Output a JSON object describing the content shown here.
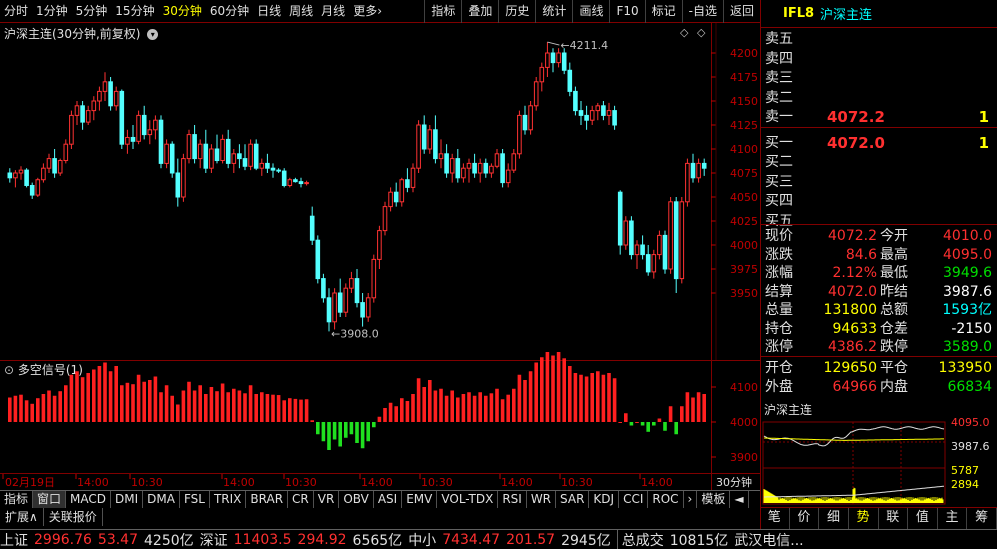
{
  "toolbar": {
    "periods": [
      "分时",
      "1分钟",
      "5分钟",
      "15分钟",
      "30分钟",
      "60分钟",
      "日线",
      "周线",
      "月线",
      "更多"
    ],
    "active_period": "30分钟",
    "more_arrow": "›",
    "right_buttons": [
      "指标",
      "叠加",
      "历史",
      "统计",
      "画线",
      "F10",
      "标记",
      "-自选",
      "返回"
    ]
  },
  "chart": {
    "title": "沪深主连(30分钟,前复权)",
    "main_yticks": [
      "4200",
      "4175",
      "4150",
      "4125",
      "4100",
      "4075",
      "4050",
      "4025",
      "4000",
      "3975",
      "3950"
    ],
    "high_label": "4211.4",
    "low_label": "3908.0",
    "sub_title": "多空信号(1)",
    "sub_yticks": [
      "4100",
      "4000",
      "3900"
    ],
    "x_labels": [
      "02月19日",
      "14:00",
      "10:30",
      "14:00",
      "10:30",
      "14:00",
      "10:30",
      "14:00",
      "10:30",
      "14:00"
    ],
    "period_label": "30分钟"
  },
  "chart_data": {
    "type": "candlestick",
    "title": "沪深主连(30分钟,前复权)",
    "ylim": [
      3900,
      4225
    ],
    "candles": [
      [
        4075,
        4080,
        4065,
        4070
      ],
      [
        4070,
        4078,
        4060,
        4075
      ],
      [
        4075,
        4082,
        4068,
        4078
      ],
      [
        4078,
        4080,
        4060,
        4062
      ],
      [
        4062,
        4065,
        4048,
        4052
      ],
      [
        4052,
        4070,
        4050,
        4068
      ],
      [
        4068,
        4085,
        4065,
        4080
      ],
      [
        4080,
        4095,
        4075,
        4090
      ],
      [
        4090,
        4100,
        4070,
        4075
      ],
      [
        4075,
        4090,
        4072,
        4088
      ],
      [
        4088,
        4110,
        4085,
        4105
      ],
      [
        4105,
        4140,
        4100,
        4135
      ],
      [
        4135,
        4150,
        4125,
        4145
      ],
      [
        4145,
        4150,
        4120,
        4128
      ],
      [
        4128,
        4145,
        4125,
        4140
      ],
      [
        4140,
        4155,
        4130,
        4150
      ],
      [
        4150,
        4165,
        4140,
        4160
      ],
      [
        4160,
        4180,
        4150,
        4170
      ],
      [
        4170,
        4175,
        4140,
        4145
      ],
      [
        4145,
        4165,
        4140,
        4160
      ],
      [
        4160,
        4162,
        4100,
        4105
      ],
      [
        4105,
        4120,
        4095,
        4112
      ],
      [
        4112,
        4125,
        4100,
        4108
      ],
      [
        4108,
        4140,
        4105,
        4135
      ],
      [
        4135,
        4145,
        4110,
        4115
      ],
      [
        4115,
        4130,
        4105,
        4120
      ],
      [
        4120,
        4135,
        4110,
        4130
      ],
      [
        4130,
        4135,
        4080,
        4085
      ],
      [
        4085,
        4110,
        4080,
        4105
      ],
      [
        4105,
        4108,
        4070,
        4075
      ],
      [
        4075,
        4090,
        4040,
        4050
      ],
      [
        4050,
        4095,
        4045,
        4090
      ],
      [
        4090,
        4120,
        4085,
        4115
      ],
      [
        4115,
        4125,
        4085,
        4090
      ],
      [
        4090,
        4110,
        4080,
        4105
      ],
      [
        4105,
        4120,
        4075,
        4080
      ],
      [
        4080,
        4105,
        4075,
        4100
      ],
      [
        4100,
        4115,
        4085,
        4088
      ],
      [
        4088,
        4115,
        4085,
        4110
      ],
      [
        4110,
        4120,
        4080,
        4085
      ],
      [
        4085,
        4100,
        4075,
        4095
      ],
      [
        4095,
        4105,
        4080,
        4090
      ],
      [
        4090,
        4105,
        4078,
        4082
      ],
      [
        4082,
        4110,
        4078,
        4105
      ],
      [
        4105,
        4110,
        4078,
        4080
      ],
      [
        4080,
        4090,
        4072,
        4085
      ],
      [
        4085,
        4095,
        4075,
        4080
      ],
      [
        4080,
        4085,
        4070,
        4078
      ],
      [
        4078,
        4080,
        4075,
        4077
      ],
      [
        4077,
        4080,
        4060,
        4062
      ],
      [
        4062,
        4070,
        4060,
        4068
      ],
      [
        4068,
        4070,
        4065,
        4066
      ],
      [
        4066,
        4070,
        4060,
        4064
      ],
      [
        4064,
        4067,
        4062,
        4065
      ],
      [
        4030,
        4040,
        4000,
        4005
      ],
      [
        4005,
        4010,
        3960,
        3965
      ],
      [
        3965,
        3970,
        3940,
        3945
      ],
      [
        3945,
        3955,
        3910,
        3920
      ],
      [
        3920,
        3955,
        3912,
        3950
      ],
      [
        3950,
        3965,
        3925,
        3930
      ],
      [
        3930,
        3960,
        3925,
        3955
      ],
      [
        3955,
        3972,
        3950,
        3965
      ],
      [
        3965,
        3975,
        3935,
        3940
      ],
      [
        3940,
        3950,
        3915,
        3925
      ],
      [
        3925,
        3950,
        3920,
        3945
      ],
      [
        3945,
        3990,
        3940,
        3985
      ],
      [
        3985,
        4020,
        3975,
        4015
      ],
      [
        4015,
        4045,
        4010,
        4040
      ],
      [
        4040,
        4060,
        4035,
        4055
      ],
      [
        4055,
        4065,
        4040,
        4045
      ],
      [
        4045,
        4070,
        4040,
        4068
      ],
      [
        4068,
        4080,
        4055,
        4060
      ],
      [
        4060,
        4085,
        4055,
        4080
      ],
      [
        4080,
        4130,
        4075,
        4125
      ],
      [
        4125,
        4135,
        4095,
        4100
      ],
      [
        4100,
        4125,
        4095,
        4120
      ],
      [
        4120,
        4135,
        4085,
        4090
      ],
      [
        4090,
        4110,
        4080,
        4095
      ],
      [
        4095,
        4105,
        4070,
        4075
      ],
      [
        4075,
        4095,
        4065,
        4090
      ],
      [
        4090,
        4100,
        4065,
        4070
      ],
      [
        4070,
        4085,
        4065,
        4080
      ],
      [
        4080,
        4090,
        4065,
        4085
      ],
      [
        4085,
        4095,
        4070,
        4075
      ],
      [
        4075,
        4090,
        4065,
        4085
      ],
      [
        4085,
        4090,
        4070,
        4075
      ],
      [
        4075,
        4085,
        4070,
        4082
      ],
      [
        4082,
        4100,
        4080,
        4095
      ],
      [
        4095,
        4100,
        4060,
        4065
      ],
      [
        4065,
        4085,
        4060,
        4078
      ],
      [
        4078,
        4100,
        4075,
        4095
      ],
      [
        4095,
        4140,
        4090,
        4135
      ],
      [
        4135,
        4145,
        4115,
        4120
      ],
      [
        4120,
        4150,
        4115,
        4145
      ],
      [
        4145,
        4175,
        4140,
        4170
      ],
      [
        4170,
        4190,
        4160,
        4185
      ],
      [
        4185,
        4211.4,
        4175,
        4200
      ],
      [
        4200,
        4205,
        4180,
        4190
      ],
      [
        4190,
        4205,
        4185,
        4200
      ],
      [
        4200,
        4205,
        4178,
        4182
      ],
      [
        4182,
        4190,
        4155,
        4160
      ],
      [
        4160,
        4165,
        4135,
        4140
      ],
      [
        4140,
        4150,
        4125,
        4135
      ],
      [
        4135,
        4145,
        4120,
        4130
      ],
      [
        4130,
        4145,
        4125,
        4140
      ],
      [
        4140,
        4148,
        4130,
        4145
      ],
      [
        4145,
        4150,
        4130,
        4135
      ],
      [
        4135,
        4148,
        4125,
        4140
      ],
      [
        4140,
        4145,
        4120,
        4125
      ],
      [
        4055,
        4057,
        3990,
        4000
      ],
      [
        4000,
        4030,
        3995,
        4025
      ],
      [
        4025,
        4030,
        3985,
        3990
      ],
      [
        3990,
        4005,
        3975,
        4000
      ],
      [
        4000,
        4010,
        3985,
        3990
      ],
      [
        3990,
        4000,
        3968,
        3972
      ],
      [
        3972,
        3995,
        3965,
        3990
      ],
      [
        3990,
        4015,
        3985,
        4010
      ],
      [
        4010,
        4015,
        3970,
        3975
      ],
      [
        3975,
        4050,
        3970,
        4045
      ],
      [
        4045,
        4050,
        3950,
        3965
      ],
      [
        3965,
        4050,
        3960,
        4045
      ],
      [
        4045,
        4090,
        4040,
        4085
      ],
      [
        4085,
        4095,
        4065,
        4070
      ],
      [
        4070,
        4090,
        4065,
        4085
      ],
      [
        4085,
        4090,
        4072,
        4080
      ]
    ],
    "signal": {
      "ylim": [
        3860,
        4140
      ],
      "baseline": 4000
    }
  },
  "quote": {
    "code": "IFL8",
    "name": "沪深主连",
    "asks": [
      {
        "label": "卖五",
        "price": "",
        "vol": ""
      },
      {
        "label": "卖四",
        "price": "",
        "vol": ""
      },
      {
        "label": "卖三",
        "price": "",
        "vol": ""
      },
      {
        "label": "卖二",
        "price": "",
        "vol": ""
      },
      {
        "label": "卖一",
        "price": "4072.2",
        "vol": "1"
      }
    ],
    "bids": [
      {
        "label": "买一",
        "price": "4072.0",
        "vol": "1"
      },
      {
        "label": "买二",
        "price": "",
        "vol": ""
      },
      {
        "label": "买三",
        "price": "",
        "vol": ""
      },
      {
        "label": "买四",
        "price": "",
        "vol": ""
      },
      {
        "label": "买五",
        "price": "",
        "vol": ""
      }
    ],
    "stats": [
      [
        "现价",
        "4072.2",
        "red",
        "今开",
        "4010.0",
        "red"
      ],
      [
        "涨跌",
        "84.6",
        "red",
        "最高",
        "4095.0",
        "red"
      ],
      [
        "涨幅",
        "2.12%",
        "red",
        "最低",
        "3949.6",
        "green"
      ],
      [
        "结算",
        "4072.0",
        "red",
        "昨结",
        "3987.6",
        "white"
      ],
      [
        "总量",
        "131800",
        "yellow",
        "总额",
        "1593亿",
        "cyan"
      ],
      [
        "持仓",
        "94633",
        "yellow",
        "仓差",
        "-2150",
        "white"
      ],
      [
        "涨停",
        "4386.2",
        "red",
        "跌停",
        "3589.0",
        "green"
      ]
    ],
    "stats2": [
      [
        "开仓",
        "129650",
        "yellow",
        "平仓",
        "133950",
        "yellow"
      ],
      [
        "外盘",
        "64966",
        "red",
        "内盘",
        "66834",
        "green"
      ]
    ]
  },
  "mini": {
    "title": "沪深主连",
    "y_top": "4095.0",
    "y_mid": "3987.6",
    "vol_top": "5787",
    "vol_mid": "2894"
  },
  "bottom_tabs": [
    "指标",
    "窗口",
    "MACD",
    "DMI",
    "DMA",
    "FSL",
    "TRIX",
    "BRAR",
    "CR",
    "VR",
    "OBV",
    "ASI",
    "EMV",
    "VOL-TDX",
    "RSI",
    "WR",
    "SAR",
    "KDJ",
    "CCI",
    "ROC",
    "›",
    "模板",
    "◄"
  ],
  "ext_tabs": [
    "扩展∧",
    "关联报价"
  ],
  "mini_tabs": [
    "笔",
    "价",
    "细",
    "势",
    "联",
    "值",
    "主",
    "筹"
  ],
  "active_mini_tab": "势",
  "status": {
    "sh_label": "上证",
    "sh_val": "2996.76",
    "sh_chg": "53.47",
    "sh_amt": "4250亿",
    "sz_label": "深证",
    "sz_val": "11403.5",
    "sz_chg": "294.92",
    "sz_amt": "6565亿",
    "zx_label": "中小",
    "zx_val": "7434.47",
    "zx_chg": "201.57",
    "zx_amt": "2945亿",
    "total_label": "总成交",
    "total_val": "10815亿",
    "news": "武汉电信..."
  }
}
